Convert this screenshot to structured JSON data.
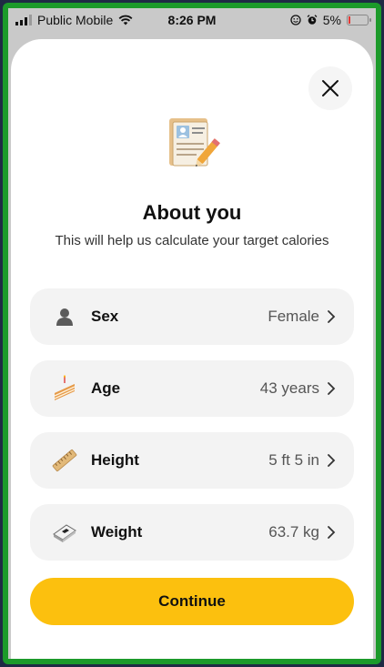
{
  "status_bar": {
    "carrier": "Public Mobile",
    "time": "8:26 PM",
    "battery": "5%"
  },
  "sheet": {
    "close_icon": "close-icon",
    "hero_icon": "clipboard-pencil-icon",
    "title": "About you",
    "subtitle": "This will help us calculate your target calories",
    "rows": [
      {
        "label": "Sex",
        "value": "Female",
        "icon": "person-silhouette-icon"
      },
      {
        "label": "Age",
        "value": "43 years",
        "icon": "cake-slice-icon"
      },
      {
        "label": "Height",
        "value": "5 ft 5 in",
        "icon": "ruler-icon"
      },
      {
        "label": "Weight",
        "value": "63.7 kg",
        "icon": "scale-icon"
      }
    ],
    "continue_label": "Continue"
  },
  "colors": {
    "accent": "#fcc00e",
    "row_bg": "#f3f3f3",
    "frame": "#1c9a2a"
  }
}
